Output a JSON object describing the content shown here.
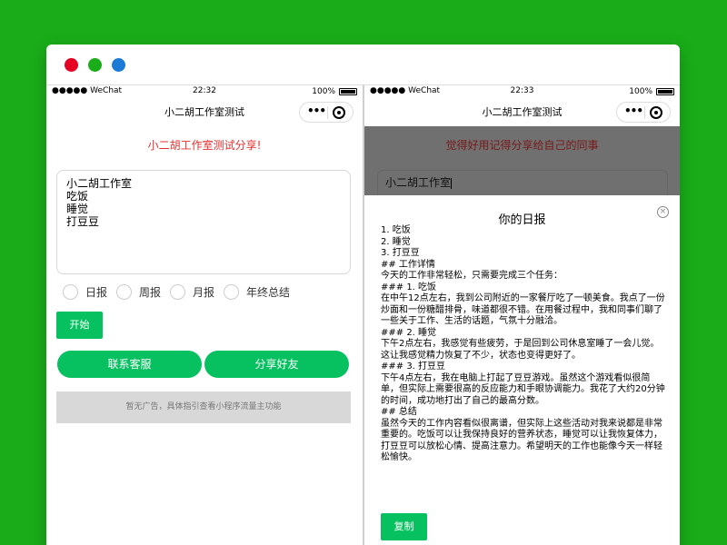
{
  "window": {
    "dots": [
      "close",
      "minimize",
      "maximize"
    ]
  },
  "left_phone": {
    "carrier": "●●●●● WeChat",
    "time": "22:32",
    "battery": "100%",
    "nav_title": "小二胡工作室测试",
    "share_tip": "小二胡工作室测试分享!",
    "input_lines": [
      "小二胡工作室",
      "吃饭",
      "睡觉",
      "打豆豆"
    ],
    "radio_options": [
      "日报",
      "周报",
      "月报",
      "年终总结"
    ],
    "start_label": "开始",
    "contact_label": "联系客服",
    "share_label": "分享好友",
    "ad_text": "暂无广告，具体指引查看小程序流量主功能"
  },
  "right_phone": {
    "carrier": "●●●●● WeChat",
    "time": "22:33",
    "battery": "100%",
    "nav_title": "小二胡工作室测试",
    "share_tip": "觉得好用记得分享给自己的同事",
    "input_value": "小二胡工作室",
    "sheet_title": "你的日报",
    "report_lines": [
      "1. 吃饭",
      "2. 睡觉",
      "3. 打豆豆",
      "## 工作详情",
      "今天的工作非常轻松，只需要完成三个任务：",
      "### 1. 吃饭",
      "在中午12点左右，我到公司附近的一家餐厅吃了一顿美食。我点了一份炒面和一份糖醋排骨，味道都很不错。在用餐过程中，我和同事们聊了一些关于工作、生活的话题，气氛十分融洽。",
      "### 2. 睡觉",
      "下午2点左右，我感觉有些疲劳，于是回到公司休息室睡了一会儿觉。这让我感觉精力恢复了不少，状态也变得更好了。",
      "### 3. 打豆豆",
      "下午4点左右，我在电脑上打起了豆豆游戏。虽然这个游戏看似很简单，但实际上需要很高的反应能力和手眼协调能力。我花了大约20分钟的时间，成功地打出了自己的最高分数。",
      "## 总结",
      "虽然今天的工作内容看似很离谱，但实际上这些活动对我来说都是非常重要的。吃饭可以让我保持良好的营养状态，睡觉可以让我恢复体力，打豆豆可以放松心情、提高注意力。希望明天的工作也能像今天一样轻松愉快。"
    ],
    "copy_label": "复制"
  },
  "colors": {
    "background": "#1aad19",
    "accent": "#07c160",
    "tip_red": "#e62e2e"
  }
}
